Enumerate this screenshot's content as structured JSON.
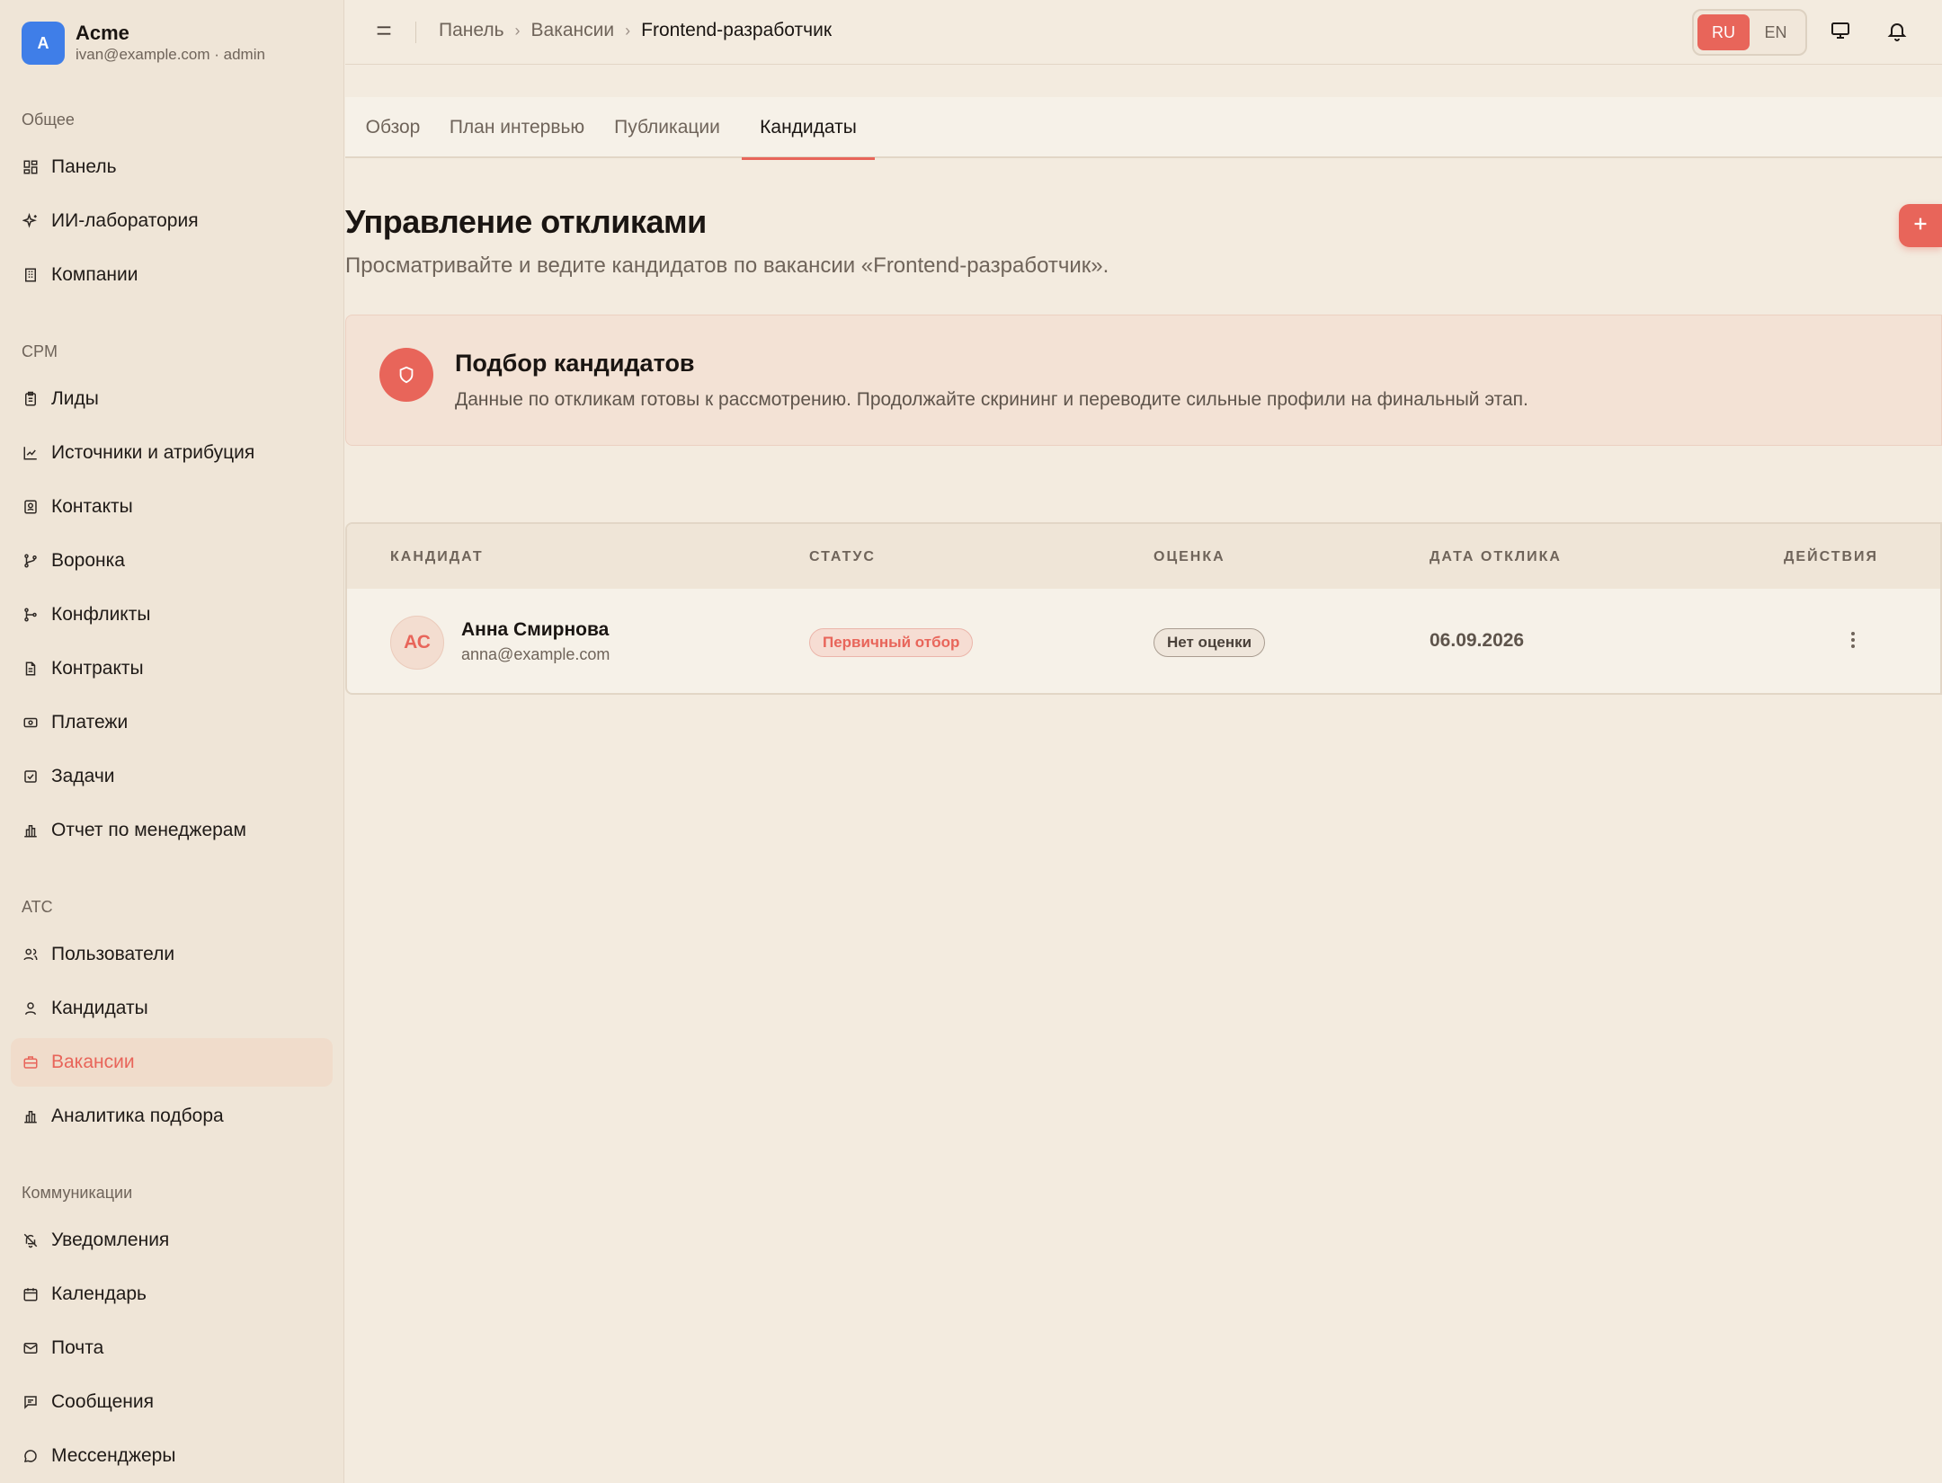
{
  "brand": {
    "avatar_letter": "A",
    "name": "Acme",
    "subtitle": "ivan@example.com · admin"
  },
  "sidebar": {
    "sections": [
      {
        "label": "Общее",
        "items": [
          {
            "label": "Панель",
            "icon": "grid-icon"
          },
          {
            "label": "ИИ-лаборатория",
            "icon": "sparkles-icon"
          },
          {
            "label": "Компании",
            "icon": "building-icon"
          }
        ]
      },
      {
        "label": "CPM",
        "items": [
          {
            "label": "Лиды",
            "icon": "clipboard-icon"
          },
          {
            "label": "Источники и атрибуция",
            "icon": "chart-line-icon"
          },
          {
            "label": "Контакты",
            "icon": "contact-icon"
          },
          {
            "label": "Воронка",
            "icon": "git-branch-icon"
          },
          {
            "label": "Конфликты",
            "icon": "git-merge-icon"
          },
          {
            "label": "Контракты",
            "icon": "file-icon"
          },
          {
            "label": "Платежи",
            "icon": "banknote-icon"
          },
          {
            "label": "Задачи",
            "icon": "check-square-icon"
          },
          {
            "label": "Отчет по менеджерам",
            "icon": "bar-chart-icon"
          }
        ]
      },
      {
        "label": "ATC",
        "items": [
          {
            "label": "Пользователи",
            "icon": "users-icon"
          },
          {
            "label": "Кандидаты",
            "icon": "user-icon"
          },
          {
            "label": "Вакансии",
            "icon": "briefcase-icon",
            "active": true
          },
          {
            "label": "Аналитика подбора",
            "icon": "bar-chart-icon"
          }
        ]
      },
      {
        "label": "Коммуникации",
        "items": [
          {
            "label": "Уведомления",
            "icon": "bell-off-icon"
          },
          {
            "label": "Календарь",
            "icon": "calendar-icon"
          },
          {
            "label": "Почта",
            "icon": "mail-icon"
          },
          {
            "label": "Сообщения",
            "icon": "message-square-icon"
          },
          {
            "label": "Мессенджеры",
            "icon": "message-circle-icon"
          }
        ]
      }
    ]
  },
  "topbar": {
    "breadcrumb": [
      "Панель",
      "Вакансии",
      "Frontend-разработчик"
    ],
    "lang": {
      "ru": "RU",
      "en": "EN",
      "active": "RU"
    },
    "icons": [
      "monitor-icon",
      "bell-icon"
    ]
  },
  "tabs": [
    {
      "label": "Обзор"
    },
    {
      "label": "План интервью"
    },
    {
      "label": "Публикации"
    },
    {
      "label": "Кандидаты",
      "active": true
    }
  ],
  "header": {
    "title": "Управление откликами",
    "subtitle": "Просматривайте и ведите кандидатов по вакансии «Frontend-разработчик»."
  },
  "banner": {
    "title": "Подбор кандидатов",
    "text": "Данные по откликам готовы к рассмотрению. Продолжайте скрининг и переводите сильные профили на финальный этап."
  },
  "table": {
    "columns": [
      "КАНДИДАТ",
      "СТАТУС",
      "ОЦЕНКА",
      "ДАТА ОТКЛИКА",
      "ДЕЙСТВИЯ"
    ],
    "rows": [
      {
        "initials": "АС",
        "name": "Анна Смирнова",
        "email": "anna@example.com",
        "status": "Первичный отбор",
        "score": "Нет оценки",
        "date": "06.09.2026"
      }
    ]
  },
  "colors": {
    "accent": "#e8655a",
    "brand_avatar": "#3f7ee8",
    "background": "#f3ebdf",
    "sidebar": "#efe5d7"
  }
}
